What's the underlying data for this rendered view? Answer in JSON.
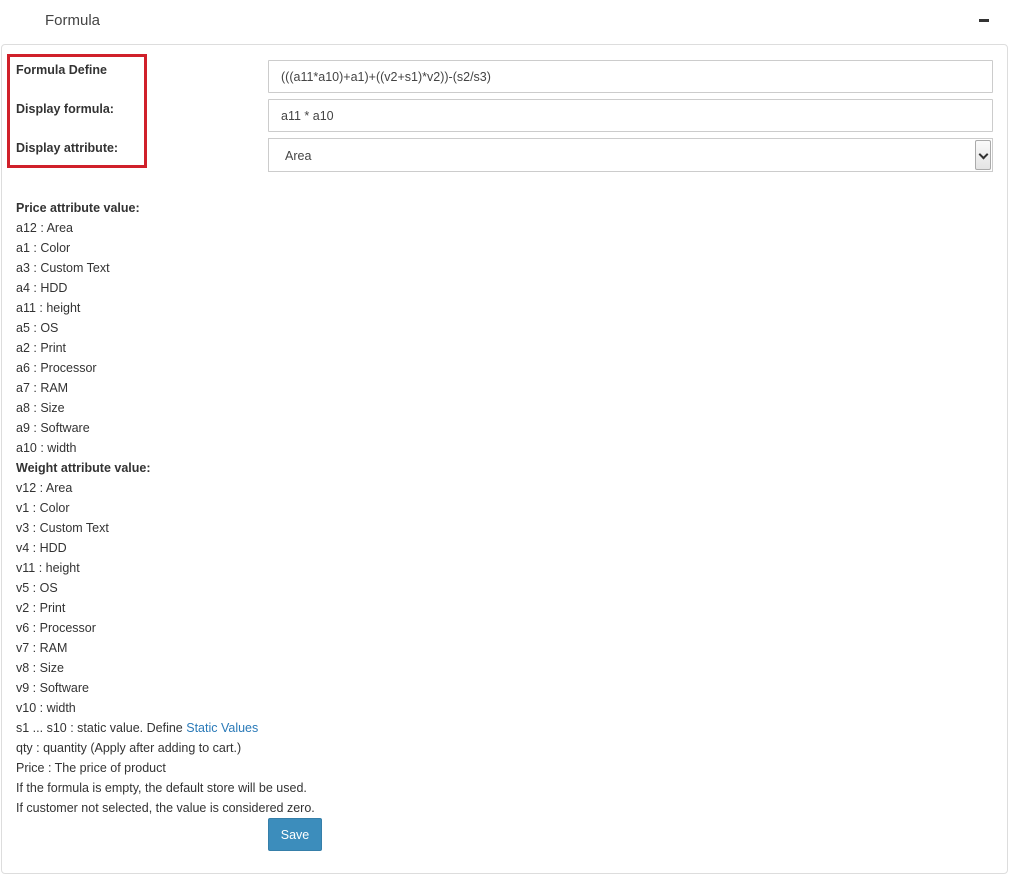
{
  "header": {
    "title": "Formula",
    "collapse_icon": "minus-icon"
  },
  "form": {
    "formula_define_label": "Formula Define",
    "formula_define_value": "(((a11*a10)+a1)+((v2+s1)*v2))-(s2/s3)",
    "display_formula_label": "Display formula:",
    "display_formula_value": "a11 * a10",
    "display_attribute_label": "Display attribute:",
    "display_attribute_value": "Area",
    "highlight_color": "#d0202a"
  },
  "price_attributes": {
    "heading": "Price attribute value:",
    "items": [
      "a12 : Area",
      "a1 : Color",
      "a3 : Custom Text",
      "a4 : HDD",
      "a11 : height",
      "a5 : OS",
      "a2 : Print",
      "a6 : Processor",
      "a7 : RAM",
      "a8 : Size",
      "a9 : Software",
      "a10 : width"
    ]
  },
  "weight_attributes": {
    "heading": "Weight attribute value:",
    "items": [
      "v12 : Area",
      "v1 : Color",
      "v3 : Custom Text",
      "v4 : HDD",
      "v11 : height",
      "v5 : OS",
      "v2 : Print",
      "v6 : Processor",
      "v7 : RAM",
      "v8 : Size",
      "v9 : Software",
      "v10 : width"
    ]
  },
  "notes": {
    "static_prefix": "s1 ... s10 : static value. Define ",
    "static_link": "Static Values",
    "qty": "qty : quantity (Apply after adding to cart.)",
    "price": "Price : The price of product",
    "empty_formula": "If the formula is empty, the default store will be used.",
    "customer": "If customer not selected, the value is considered zero."
  },
  "actions": {
    "save_label": "Save",
    "accent_color": "#3c8dbc"
  }
}
